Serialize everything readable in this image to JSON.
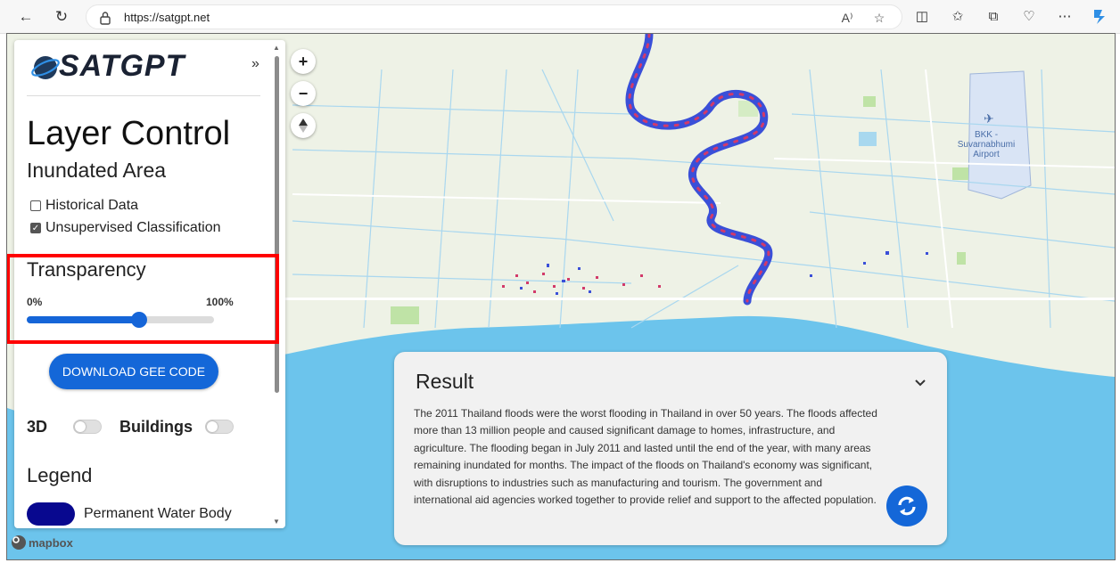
{
  "browser": {
    "url": "https://satgpt.net",
    "back_icon": "arrow-left-icon",
    "reload_icon": "reload-icon"
  },
  "panel": {
    "logo_text": "SATGPT",
    "collapse": "»",
    "title": "Layer Control",
    "subtitle": "Inundated Area",
    "checkboxes": [
      {
        "label": "Historical Data",
        "checked": false
      },
      {
        "label": "Unsupervised Classification",
        "checked": true
      }
    ],
    "transparency": {
      "title": "Transparency",
      "min_label": "0%",
      "max_label": "100%",
      "value_fraction": 0.6
    },
    "download_button": "DOWNLOAD GEE CODE",
    "toggles": {
      "threed": "3D",
      "buildings": "Buildings"
    },
    "legend": {
      "title": "Legend",
      "items": [
        {
          "label": "Permanent Water Body",
          "color": "#08088f"
        }
      ]
    }
  },
  "map": {
    "airport_label": "BKK -\nSuvarnabhumi\nAirport",
    "attribution": "mapbox",
    "zoom_in": "+",
    "zoom_out": "−"
  },
  "result": {
    "title": "Result",
    "text": "The 2011 Thailand floods were the worst flooding in Thailand in over 50 years. The floods affected more than 13 million people and caused significant damage to homes, infrastructure, and agriculture. The flooding began in July 2011 and lasted until the end of the year, with many areas remaining inundated for months. The impact of the floods on Thailand's economy was significant, with disruptions to industries such as manufacturing and tourism. The government and international aid agencies worked together to provide relief and support to the affected population."
  },
  "colors": {
    "accent": "#1467d8",
    "highlight": "#ff0000",
    "water": "#6cc4ec",
    "land": "#eef2e6"
  }
}
